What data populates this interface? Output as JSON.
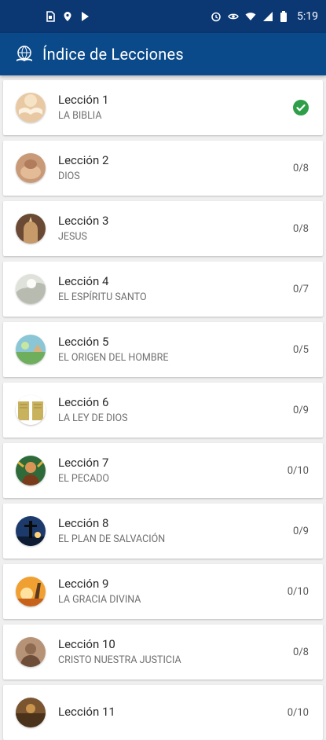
{
  "status_bar": {
    "time": "5:19",
    "left_icons": [
      "sim-card-icon",
      "location-icon",
      "play-store-icon"
    ],
    "right_icons": [
      "alarm-icon",
      "eye-icon",
      "wifi-icon",
      "signal-icon",
      "battery-icon"
    ]
  },
  "app_bar": {
    "title": "Índice de Lecciones",
    "logo_icon": "globe-book-logo"
  },
  "colors": {
    "status_bar": "#0b3773",
    "app_bar": "#0b4a8a",
    "check": "#2e9e48"
  },
  "lessons": [
    {
      "title": "Lección 1",
      "subtitle": "LA BIBLIA",
      "progress": "",
      "completed": true
    },
    {
      "title": "Lección 2",
      "subtitle": "DIOS",
      "progress": "0/8",
      "completed": false
    },
    {
      "title": "Lección 3",
      "subtitle": "JESUS",
      "progress": "0/8",
      "completed": false
    },
    {
      "title": "Lección 4",
      "subtitle": "EL ESPÍRITU SANTO",
      "progress": "0/7",
      "completed": false
    },
    {
      "title": "Lección 5",
      "subtitle": "EL ORIGEN DEL HOMBRE",
      "progress": "0/5",
      "completed": false
    },
    {
      "title": "Lección 6",
      "subtitle": "LA LEY DE DIOS",
      "progress": "0/9",
      "completed": false
    },
    {
      "title": "Lección 7",
      "subtitle": "EL PECADO",
      "progress": "0/10",
      "completed": false
    },
    {
      "title": "Lección 8",
      "subtitle": "EL PLAN DE SALVACIÓN",
      "progress": "0/9",
      "completed": false
    },
    {
      "title": "Lección 9",
      "subtitle": "LA GRACIA DIVINA",
      "progress": "0/10",
      "completed": false
    },
    {
      "title": "Lección 10",
      "subtitle": "CRISTO NUESTRA JUSTICIA",
      "progress": "0/8",
      "completed": false
    },
    {
      "title": "Lección 11",
      "subtitle": "",
      "progress": "0/10",
      "completed": false
    }
  ]
}
